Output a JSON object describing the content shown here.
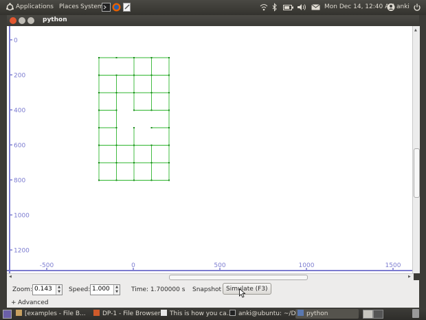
{
  "top_panel": {
    "menu": [
      "Applications",
      "Places",
      "System"
    ],
    "datetime": "Mon Dec 14, 12:40 AM",
    "user": "anki"
  },
  "window": {
    "title": "python"
  },
  "canvas": {
    "y_ticks": [
      "0",
      "200",
      "400",
      "600",
      "800",
      "1000",
      "1200"
    ],
    "x_ticks": [
      "-500",
      "0",
      "500",
      "1000",
      "1500"
    ],
    "grid_color": "#2db52d",
    "axis_color": "#7b7bd0"
  },
  "controls": {
    "zoom_label": "Zoom:",
    "zoom_value": "0.143",
    "speed_label": "Speed:",
    "speed_value": "1.000",
    "time_text": "Time: 1.700000 s",
    "snapshot_label": "Snapshot",
    "simulate_label": "Simulate (F3)",
    "advanced_label": "Advanced",
    "advanced_toggle": "+"
  },
  "taskbar": [
    {
      "label": "[examples - File B..."
    },
    {
      "label": "DP-1 - File Browser"
    },
    {
      "label": "This is how you ca..."
    },
    {
      "label": "anki@ubuntu: ~/D..."
    },
    {
      "label": "python"
    }
  ]
}
